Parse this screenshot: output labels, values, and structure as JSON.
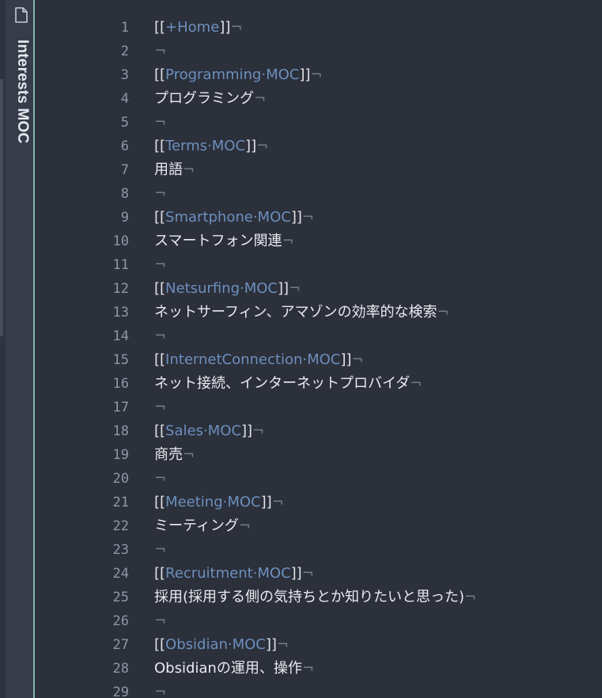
{
  "sidebar": {
    "tab_title": "Interests MOC",
    "icon": "file-icon"
  },
  "editor": {
    "eol_marker": "¬",
    "lines": [
      {
        "n": "1",
        "type": "link",
        "link": "+Home"
      },
      {
        "n": "2",
        "type": "blank"
      },
      {
        "n": "3",
        "type": "link",
        "link": "Programming·MOC"
      },
      {
        "n": "4",
        "type": "text",
        "text": "プログラミング"
      },
      {
        "n": "5",
        "type": "blank"
      },
      {
        "n": "6",
        "type": "link",
        "link": "Terms·MOC"
      },
      {
        "n": "7",
        "type": "text",
        "text": "用語"
      },
      {
        "n": "8",
        "type": "blank"
      },
      {
        "n": "9",
        "type": "link",
        "link": "Smartphone·MOC"
      },
      {
        "n": "10",
        "type": "text",
        "text": "スマートフォン関連"
      },
      {
        "n": "11",
        "type": "blank"
      },
      {
        "n": "12",
        "type": "link",
        "link": "Netsurfing·MOC"
      },
      {
        "n": "13",
        "type": "text",
        "text": "ネットサーフィン、アマゾンの効率的な検索"
      },
      {
        "n": "14",
        "type": "blank"
      },
      {
        "n": "15",
        "type": "link",
        "link": "InternetConnection·MOC"
      },
      {
        "n": "16",
        "type": "text",
        "text": "ネット接続、インターネットプロバイダ"
      },
      {
        "n": "17",
        "type": "blank"
      },
      {
        "n": "18",
        "type": "link",
        "link": "Sales·MOC"
      },
      {
        "n": "19",
        "type": "text",
        "text": "商売"
      },
      {
        "n": "20",
        "type": "blank"
      },
      {
        "n": "21",
        "type": "link",
        "link": "Meeting·MOC"
      },
      {
        "n": "22",
        "type": "text",
        "text": "ミーティング"
      },
      {
        "n": "23",
        "type": "blank"
      },
      {
        "n": "24",
        "type": "link",
        "link": "Recruitment·MOC"
      },
      {
        "n": "25",
        "type": "text",
        "text": "採用(採用する側の気持ちとか知りたいと思った)"
      },
      {
        "n": "26",
        "type": "blank"
      },
      {
        "n": "27",
        "type": "link",
        "link": "Obsidian·MOC"
      },
      {
        "n": "28",
        "type": "text",
        "text": "Obsidianの運用、操作"
      },
      {
        "n": "29",
        "type": "blank"
      }
    ]
  }
}
